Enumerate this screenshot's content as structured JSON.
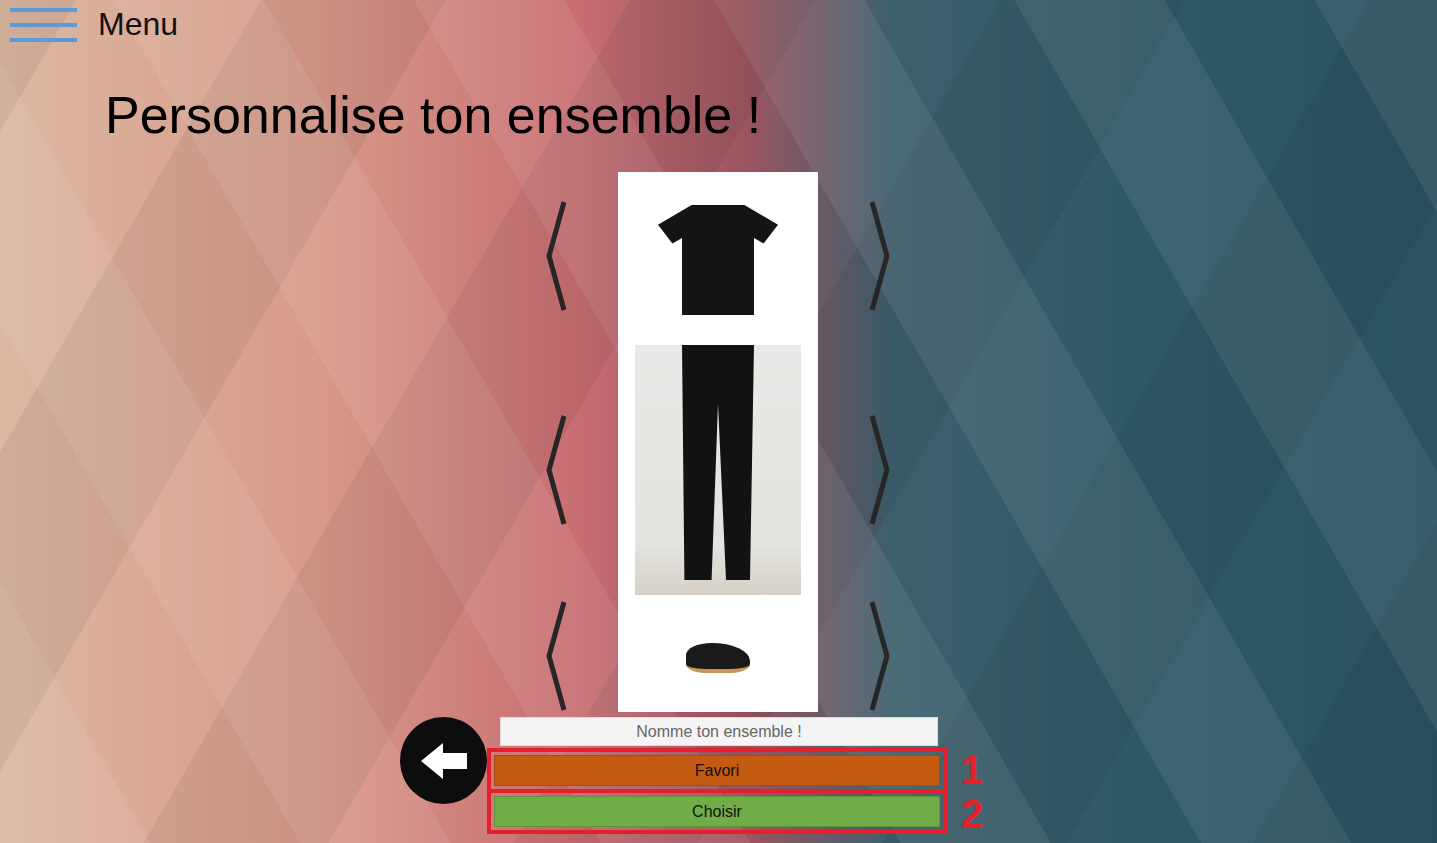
{
  "menu": {
    "label": "Menu"
  },
  "title": "Personnalise ton ensemble !",
  "name_field": {
    "placeholder": "Nomme ton ensemble !"
  },
  "buttons": [
    {
      "label": "Favori",
      "color": "#c55a11",
      "marker": "1"
    },
    {
      "label": "Choisir",
      "color": "#70ad47",
      "marker": "2"
    }
  ]
}
